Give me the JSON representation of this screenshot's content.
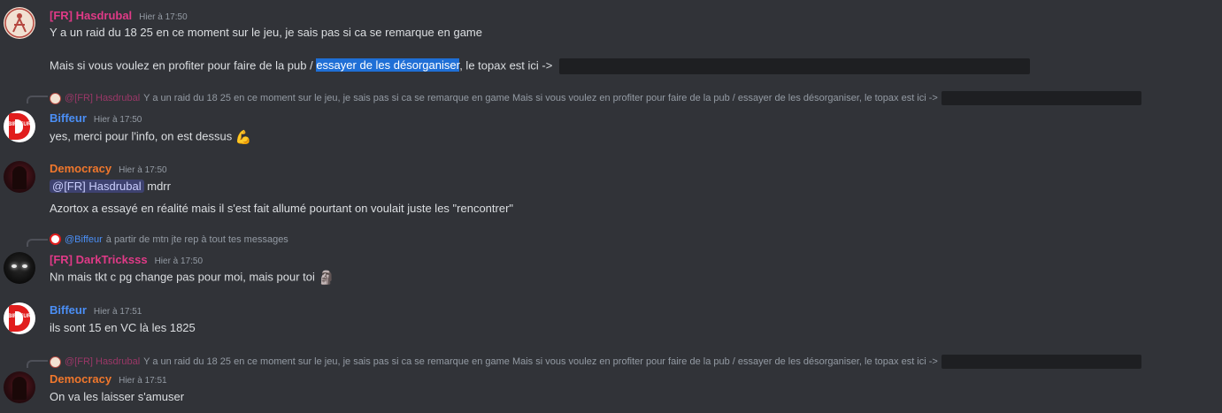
{
  "messages": [
    {
      "author": "[FR] Hasdrubal",
      "time": "Hier à 17:50",
      "color": "#e03a87",
      "line1": "Y a un raid du 18 25 en ce moment sur le jeu, je sais pas si ca se remarque en game",
      "line2_a": "Mais si vous voulez en profiter pour faire de la pub / ",
      "line2_hl": "essayer de les désorganiser",
      "line2_b": ", le topax est ici ->"
    },
    {
      "reply_author": "@[FR] Hasdrubal",
      "reply_text": "Y a un raid du 18 25 en ce moment sur le jeu, je sais pas si ca se remarque en game Mais si vous voulez en profiter pour faire de la pub / essayer de les désorganiser, le topax est ici ->",
      "author": "Biffeur",
      "time": "Hier à 17:50",
      "color": "#4b8ff6",
      "text": "yes, merci pour l'info, on est dessus",
      "emoji": "💪"
    },
    {
      "author": "Democracy",
      "time": "Hier à 17:50",
      "color": "#f0772c",
      "mention": "@[FR] Hasdrubal",
      "mention_tail": " mdrr",
      "line2": "Azortox a essayé en réalité mais il s'est fait allumé pourtant on voulait juste les \"rencontrer\""
    },
    {
      "reply_author": "@Biffeur",
      "reply_text": "à partir de mtn jte rep à tout tes messages",
      "author": "[FR] DarkTricksss",
      "time": "Hier à 17:50",
      "color": "#e03a87",
      "text": "Nn mais tkt c pg change pas pour moi, mais pour toi",
      "emoji": "🗿"
    },
    {
      "author": "Biffeur",
      "time": "Hier à 17:51",
      "color": "#4b8ff6",
      "text": "ils sont 15 en VC là les 1825"
    },
    {
      "reply_author": "@[FR] Hasdrubal",
      "reply_text": "Y a un raid du 18 25 en ce moment sur le jeu, je sais pas si ca se remarque en game Mais si vous voulez en profiter pour faire de la pub / essayer de les désorganiser, le topax est ici ->",
      "author": "Democracy",
      "time": "Hier à 17:51",
      "color": "#f0772c",
      "text": "On va les laisser s'amuser"
    }
  ],
  "avatars": {
    "biffeur_label": "BIFFEUR",
    "biffeur_letter": "D"
  }
}
